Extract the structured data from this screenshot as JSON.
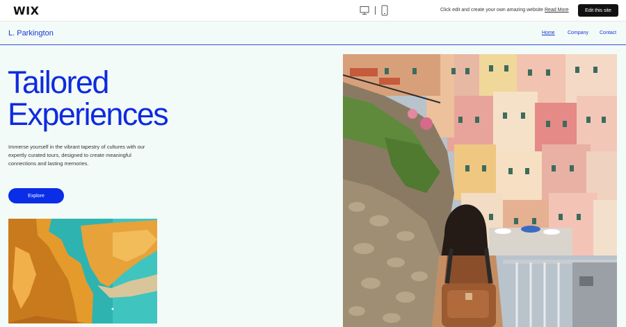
{
  "wix_bar": {
    "logo": "WIX",
    "promo_text": "Click edit and create your own amazing website",
    "read_more": "Read More",
    "edit_button": "Edit this site",
    "icons": [
      "desktop-icon",
      "mobile-icon"
    ]
  },
  "site": {
    "brand": "L. Parkington",
    "nav": [
      "Home",
      "Company",
      "Contact"
    ],
    "active_nav": "Home"
  },
  "hero": {
    "title_line1": "Tailored",
    "title_line2": "Experiences",
    "description": "Immerse yourself in the vibrant tapestry of cultures with our expertly curated tours, designed to create meaningful connections and lasting memories.",
    "button": "Explore"
  },
  "colors": {
    "accent": "#0f2bde",
    "button": "#0a2de8",
    "background": "#f3fbf8",
    "wix_button": "#111111"
  }
}
